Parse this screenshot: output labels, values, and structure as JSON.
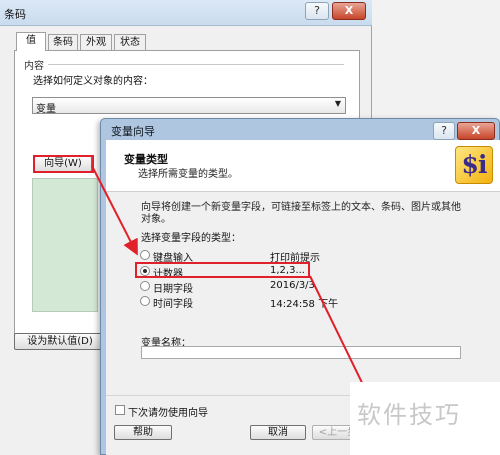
{
  "back_dialog": {
    "title": "条码",
    "help_btn": "?",
    "close_btn": "X",
    "tabs": [
      {
        "label": "值"
      },
      {
        "label": "条码"
      },
      {
        "label": "外观"
      },
      {
        "label": "状态"
      }
    ],
    "group_label": "内容",
    "prompt": "选择如何定义对象的内容：",
    "source_select_value": "变量",
    "wizard_button": "向导(W)",
    "set_default_button": "设为默认值(D)"
  },
  "wizard": {
    "title": "变量向导",
    "help_btn": "?",
    "close_btn": "X",
    "header_title": "变量类型",
    "header_subtitle": "选择所需变量的类型。",
    "logo_text": "$i",
    "description": "向导将创建一个新变量字段，可链接至标签上的文本、条码、图片或其他对象。",
    "field_type_label": "选择变量字段的类型：",
    "options": [
      {
        "label": "键盘输入",
        "example": "打印前提示",
        "checked": false
      },
      {
        "label": "计数器",
        "example": "1,2,3...",
        "checked": true
      },
      {
        "label": "日期字段",
        "example": "2016/3/3",
        "checked": false
      },
      {
        "label": "时间字段",
        "example": "14:24:58 下午",
        "checked": false
      }
    ],
    "var_name_label": "变量名称：",
    "var_name_value": "",
    "no_wizard_label": "下次请勿使用向导",
    "help_button": "帮助",
    "cancel_button": "取消",
    "back_button": "<上一步"
  },
  "annotation_color": "#e0202a",
  "watermark": "软件技巧"
}
